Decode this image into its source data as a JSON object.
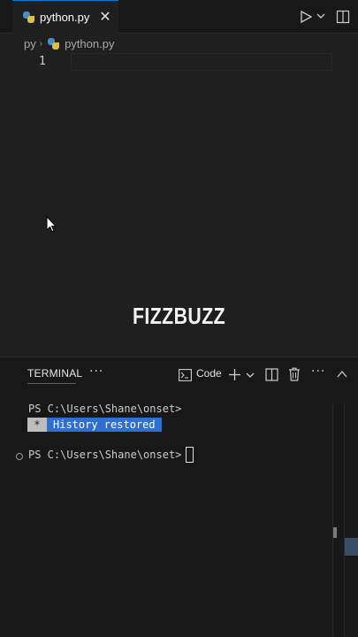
{
  "tab": {
    "filename": "python.py",
    "close_glyph": "✕"
  },
  "breadcrumb": {
    "folder": "py",
    "separator": "›",
    "file": "python.py"
  },
  "editor": {
    "line_number": "1",
    "overlay_title": "FIZZBUZZ"
  },
  "panel": {
    "active_tab": "TERMINAL",
    "more": "···",
    "terminal_name": "Code",
    "panel_more": "···"
  },
  "terminal": {
    "prompt_line_1": "PS C:\\Users\\Shane\\onset>",
    "history_star": "*",
    "history_message": "History restored",
    "prompt_line_2": "PS C:\\Users\\Shane\\onset>"
  },
  "colors": {
    "accent": "#0078d4",
    "history_highlight": "#2f6fcf",
    "python_blue": "#4a8cc4",
    "python_yellow": "#d9c04a"
  },
  "icons": [
    "python-file-icon",
    "close-icon",
    "run-icon",
    "chevron-down-icon",
    "split-editor-icon",
    "terminal-icon",
    "plus-icon",
    "split-terminal-icon",
    "trash-icon",
    "chevron-up-icon",
    "mouse-pointer-icon"
  ]
}
